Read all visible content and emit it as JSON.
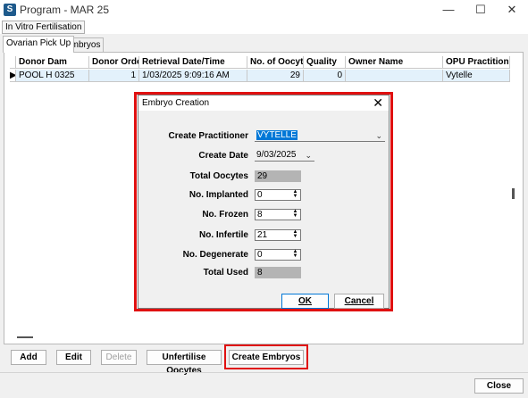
{
  "window": {
    "title": "Program - MAR 25",
    "app_icon": "S",
    "minimize_glyph": "—",
    "maximize_glyph": "☐",
    "close_glyph": "✕"
  },
  "menu": {
    "item": "In Vitro Fertilisation"
  },
  "tabs": {
    "ovarian": "Ovarian Pick Up",
    "embryos": "Embryos"
  },
  "grid": {
    "columns": [
      "Donor Dam",
      "Donor Order",
      "Retrieval Date/Time",
      "No. of Oocytes",
      "Quality",
      "Owner Name",
      "OPU Practitioner"
    ],
    "rows": [
      {
        "indicator": "▶",
        "donor_dam": "POOL H 0325",
        "donor_order": "1",
        "retrieval": "1/03/2025 9:09:16 AM",
        "oocytes": "29",
        "quality": "0",
        "owner": "",
        "practitioner": "Vytelle"
      }
    ]
  },
  "buttons": {
    "add": "Add",
    "edit": "Edit",
    "delete": "Delete",
    "unfertilise": "Unfertilise Oocytes",
    "create_embryos": "Create Embryos",
    "close": "Close"
  },
  "dialog": {
    "title": "Embryo Creation",
    "close_glyph": "✕",
    "labels": {
      "create_practitioner": "Create Practitioner",
      "create_date": "Create Date",
      "total_oocytes": "Total Oocytes",
      "no_implanted": "No. Implanted",
      "no_frozen": "No. Frozen",
      "no_infertile": "No. Infertile",
      "no_degenerate": "No. Degenerate",
      "total_used": "Total Used"
    },
    "values": {
      "create_practitioner": "VYTELLE",
      "create_date": "9/03/2025",
      "total_oocytes": "29",
      "no_implanted": "0",
      "no_frozen": "8",
      "no_infertile": "21",
      "no_degenerate": "0",
      "total_used": "8"
    },
    "ok": "OK",
    "cancel": "Cancel"
  },
  "colors": {
    "highlight_outline": "#e01010",
    "selection": "#0078d7",
    "row_selected": "#e3f1fb"
  }
}
